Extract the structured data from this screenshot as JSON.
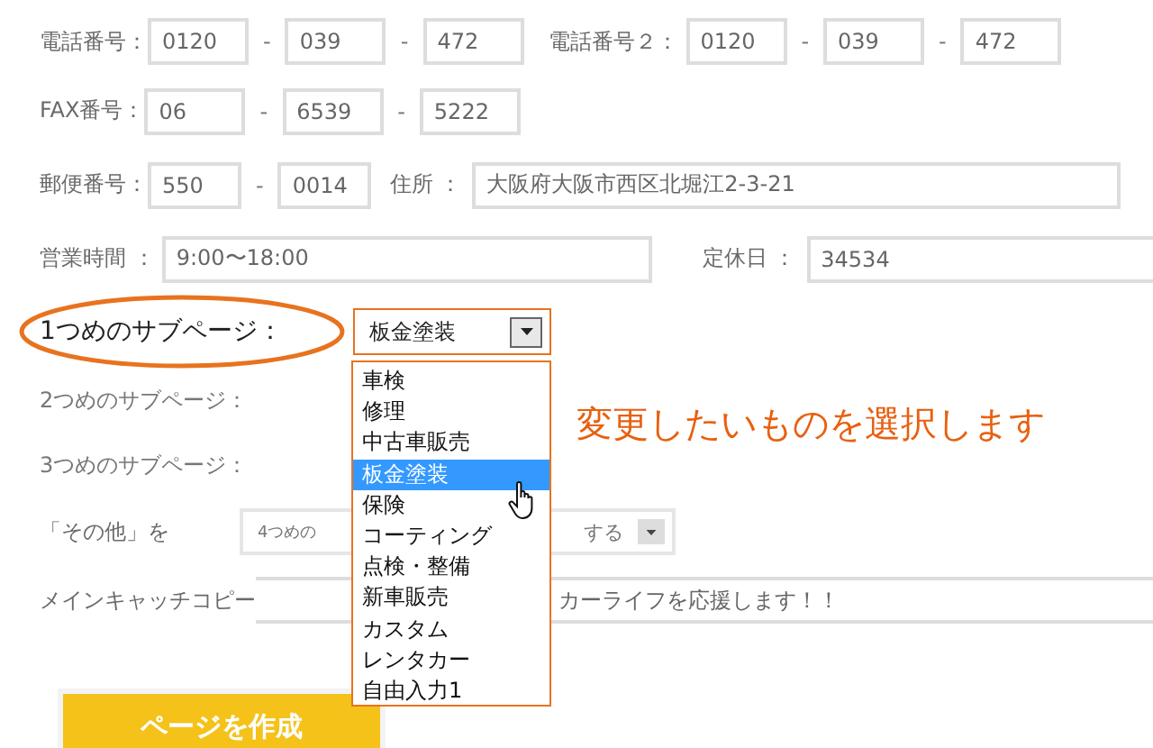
{
  "phone": {
    "label": "電話番号：",
    "separator": "-",
    "parts": [
      "0120",
      "039",
      "472"
    ]
  },
  "phone2": {
    "label": "電話番号２：",
    "separator": "-",
    "parts": [
      "0120",
      "039",
      "472"
    ]
  },
  "fax": {
    "label": "FAX番号：",
    "separator": "-",
    "parts": [
      "06",
      "6539",
      "5222"
    ]
  },
  "postal": {
    "label": "郵便番号：",
    "separator": "-",
    "parts": [
      "550",
      "0014"
    ]
  },
  "address": {
    "label": "住所 ：",
    "value": "大阪府大阪市西区北堀江2-3-21"
  },
  "hours": {
    "label": "営業時間 ：",
    "value": "9:00〜18:00"
  },
  "holiday": {
    "label": "定休日 ：",
    "value": "34534"
  },
  "subpages": [
    {
      "label": "1つめのサブページ：",
      "highlighted": true,
      "value": "板金塗装"
    },
    {
      "label": "2つめのサブページ：",
      "highlighted": false
    },
    {
      "label": "3つめのサブページ：",
      "highlighted": false
    }
  ],
  "other": {
    "label": "「その他」を",
    "value_start": "4つめの",
    "value_end": "する"
  },
  "catch_copy": {
    "label": "メインキャッチコピー",
    "value": "カーライフを応援します！！"
  },
  "dropdown": {
    "options": [
      {
        "label": "車検",
        "selected": false
      },
      {
        "label": "修理",
        "selected": false
      },
      {
        "label": "中古車販売",
        "selected": false
      },
      {
        "label": "板金塗装",
        "selected": true
      },
      {
        "label": "保険",
        "selected": false
      },
      {
        "label": "コーティング",
        "selected": false
      },
      {
        "label": "点検・整備",
        "selected": false
      },
      {
        "label": "新車販売",
        "selected": false
      },
      {
        "label": "カスタム",
        "selected": false
      },
      {
        "label": "レンタカー",
        "selected": false
      },
      {
        "label": "自由入力1",
        "selected": false
      }
    ]
  },
  "callout": "変更したいものを選択します",
  "submit": {
    "label": "ページを作成"
  }
}
